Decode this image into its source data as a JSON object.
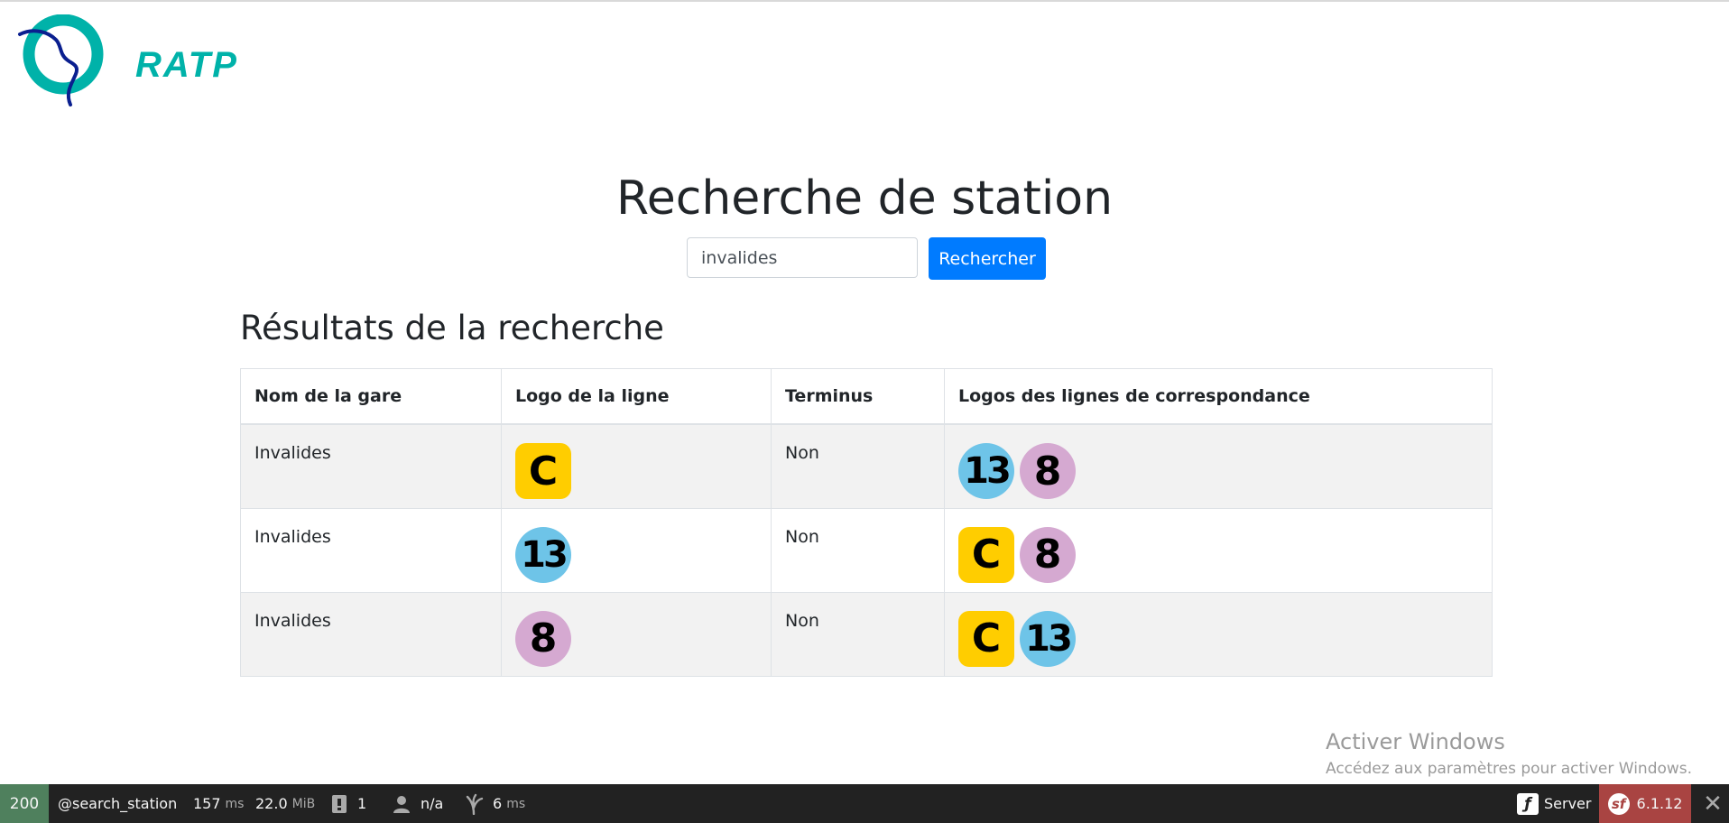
{
  "brand": {
    "name": "RATP"
  },
  "page": {
    "title": "Recherche de station"
  },
  "search": {
    "value": "invalides",
    "button_label": "Rechercher"
  },
  "results": {
    "title": "Résultats de la recherche",
    "headers": [
      "Nom de la gare",
      "Logo de la ligne",
      "Terminus",
      "Logos des lignes de correspondance"
    ],
    "rows": [
      {
        "station": "Invalides",
        "line": "C",
        "terminus": "Non",
        "connections": [
          "13",
          "8"
        ]
      },
      {
        "station": "Invalides",
        "line": "13",
        "terminus": "Non",
        "connections": [
          "C",
          "8"
        ]
      },
      {
        "station": "Invalides",
        "line": "8",
        "terminus": "Non",
        "connections": [
          "C",
          "13"
        ]
      }
    ]
  },
  "line_colors": {
    "C": "#ffcd00",
    "13": "#6ec4e8",
    "8": "#d5a9d1"
  },
  "line_shapes": {
    "C": "rounded",
    "13": "circle",
    "8": "circle"
  },
  "watermark": {
    "title": "Activer Windows",
    "subtitle": "Accédez aux paramètres pour activer Windows."
  },
  "debug_toolbar": {
    "status": "200",
    "route": "@search_station",
    "time_value": "157",
    "time_unit": "ms",
    "memory_value": "22.0",
    "memory_unit": "MiB",
    "logs_count": "1",
    "user": "n/a",
    "twig_value": "6",
    "twig_unit": "ms",
    "server_label": "Server",
    "version": "6.1.12"
  }
}
